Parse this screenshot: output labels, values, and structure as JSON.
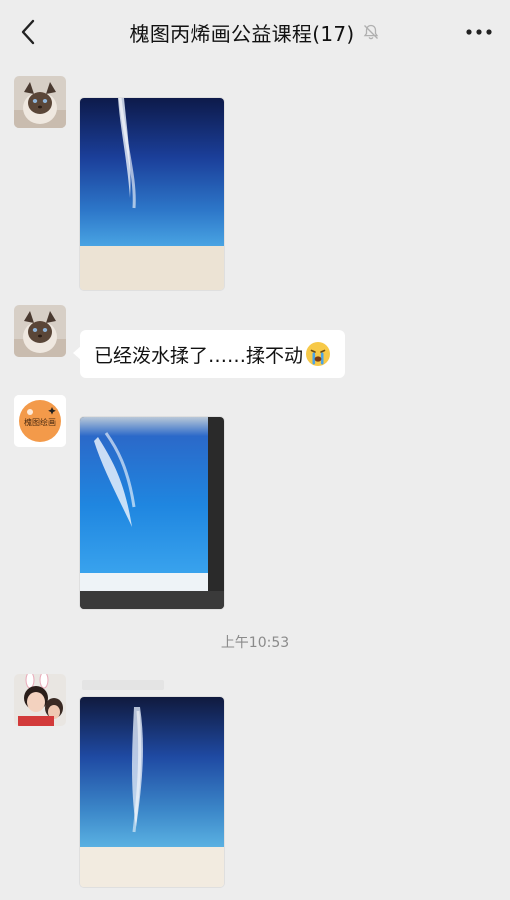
{
  "header": {
    "title": "槐图丙烯画公益课程(17)",
    "back_icon": "chevron-left-icon",
    "mute_icon": "bell-muted-icon",
    "more_icon": "more-dots-icon"
  },
  "messages": [
    {
      "type": "image",
      "sender_avatar": "cat-avatar",
      "content": "painting of blue ocean with white waterspout"
    },
    {
      "type": "text",
      "sender_avatar": "cat-avatar",
      "text": "已经泼水揉了……揉不动",
      "emoji": "crying-face-icon"
    },
    {
      "type": "image",
      "sender_avatar": "orange-logo-avatar",
      "avatar_text": "槐图绘画",
      "content": "painting of bright blue ocean with waterspout"
    },
    {
      "type": "timestamp",
      "text": "上午10:53"
    },
    {
      "type": "image",
      "sender_avatar": "bunny-ears-avatar",
      "content": "painting of deep blue ocean with waterspout"
    }
  ],
  "colors": {
    "background": "#ededed",
    "bubble": "#ffffff",
    "timestamp": "#8a8a8a",
    "avatar_orange": "#f39a4a"
  }
}
